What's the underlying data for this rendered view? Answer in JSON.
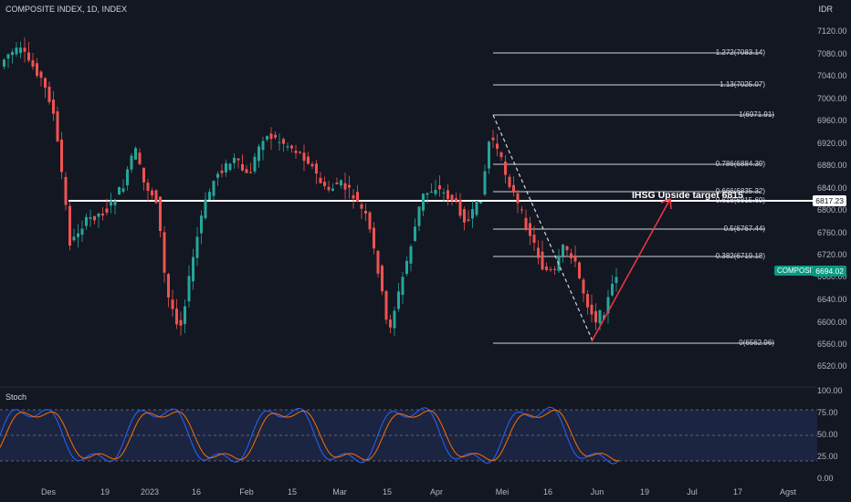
{
  "header": {
    "title": "COMPOSITE INDEX, 1D, INDEX",
    "currency": "IDR"
  },
  "price_axis": [
    "7120.00",
    "7080.00",
    "7040.00",
    "7000.00",
    "6960.00",
    "6920.00",
    "6880.00",
    "6840.00",
    "6800.00",
    "6760.00",
    "6720.00",
    "6680.00",
    "6640.00",
    "6600.00",
    "6560.00",
    "6520.00"
  ],
  "stoch_axis": [
    "100.00",
    "75.00",
    "50.00",
    "25.00",
    "0.00"
  ],
  "x_axis": [
    "Des",
    "19",
    "2023",
    "16",
    "Feb",
    "15",
    "Mar",
    "15",
    "Apr",
    "Mei",
    "16",
    "Jun",
    "19",
    "Jul",
    "17",
    "Agst"
  ],
  "fib_labels": [
    "1.272(7083.14)",
    "1.13(7025.07)",
    "1(6971.91)",
    "0.786(6884.39)",
    "0.666(6835.32)",
    "0.618(6815.69)",
    "0.5(6767.44)",
    "0.382(6719.18)",
    "0(6562.96)"
  ],
  "price_badge": {
    "value": "6817.23"
  },
  "composite_badge": {
    "label": "COMPOSITE",
    "value": "6694.02"
  },
  "annotation": "IHSG Upside target 6815",
  "stoch": {
    "label": "Stoch"
  },
  "colors": {
    "up": "#26a69a",
    "down": "#ef5350",
    "k_line": "#2962ff",
    "d_line": "#ff6d00"
  },
  "chart_data": {
    "type": "candlestick",
    "ylim": [
      6520,
      7130
    ],
    "horizontal_line": 6817.23,
    "fib_levels": [
      7083.14,
      7025.07,
      6971.91,
      6884.39,
      6835.32,
      6815.69,
      6767.44,
      6719.18,
      6562.96
    ],
    "last_close": 6694.02,
    "stoch_levels": [
      80,
      50,
      20
    ]
  }
}
